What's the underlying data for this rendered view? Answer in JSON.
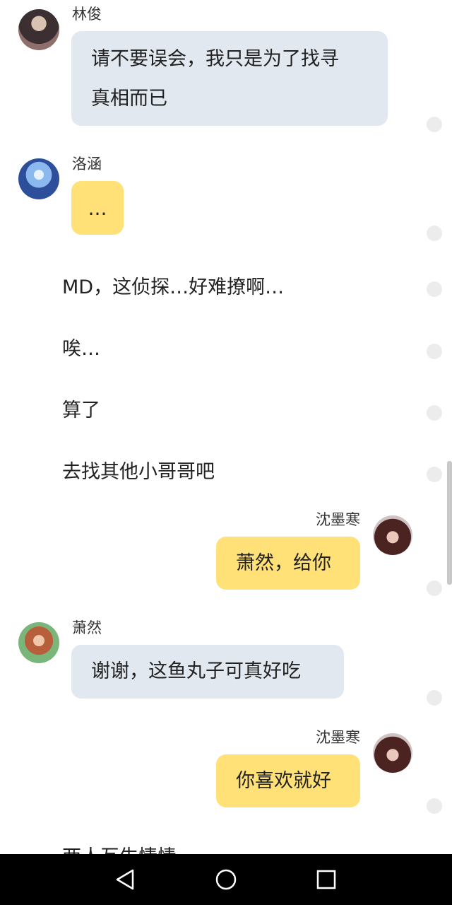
{
  "messages": [
    {
      "sender": "林俊",
      "text_line1": "请不要误会，我只是为了找寻",
      "text_line2": "真相而已"
    },
    {
      "sender": "洛涵",
      "text": "…"
    },
    {
      "narration": "MD，这侦探…好难撩啊…"
    },
    {
      "narration": "唉…"
    },
    {
      "narration": "算了"
    },
    {
      "narration": "去找其他小哥哥吧"
    },
    {
      "sender": "沈墨寒",
      "text": "萧然，给你"
    },
    {
      "sender": "萧然",
      "text": "谢谢，这鱼丸子可真好吃"
    },
    {
      "sender": "沈墨寒",
      "text": "你喜欢就好"
    },
    {
      "narration": "两人互生情愫"
    }
  ],
  "nav": {
    "back": "back-icon",
    "home": "home-icon",
    "recents": "recents-icon"
  },
  "colors": {
    "gray_bubble": "#e2e8f0",
    "yellow_bubble": "#ffe178",
    "navbar": "#000000"
  }
}
